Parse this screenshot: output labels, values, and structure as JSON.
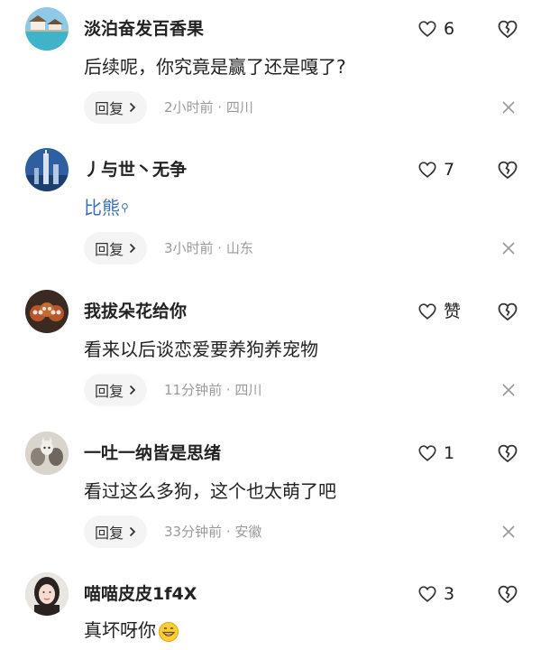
{
  "comments": [
    {
      "username": "淡泊奋发百香果",
      "like_count": "6",
      "text": "后续呢，你究竟是赢了还是嘎了?",
      "reply_label": "回复",
      "meta": "2小时前 · 四川",
      "avatar": "beach-house-avatar"
    },
    {
      "username": "丿与世丶无争",
      "like_count": "7",
      "text": "比熊",
      "reply_label": "回复",
      "meta": "3小时前 · 山东",
      "avatar": "tower-avatar"
    },
    {
      "username": "我拔朵花给你",
      "like_count": "赞",
      "text": "看来以后谈恋爱要养狗养宠物",
      "reply_label": "回复",
      "meta": "11分钟前 · 四川",
      "avatar": "red-panda-avatar"
    },
    {
      "username": "一吐一纳皆是思绪",
      "like_count": "1",
      "text": "看过这么多狗，这个也太萌了吧",
      "reply_label": "回复",
      "meta": "33分钟前 · 安徽",
      "avatar": "cats-avatar"
    },
    {
      "username": "喵喵皮皮1f4X",
      "like_count": "3",
      "text": "真坏呀你",
      "avatar": "girl-avatar"
    }
  ],
  "icons": {
    "like": "heart-outline-icon",
    "dislike": "broken-heart-icon",
    "close": "close-icon",
    "search_hint": "search-icon",
    "emoji": "grinning-emoji-icon"
  },
  "colors": {
    "link": "#3c6fb9",
    "meta": "#9a9a9a",
    "reply_bg": "#f4f4f4"
  }
}
